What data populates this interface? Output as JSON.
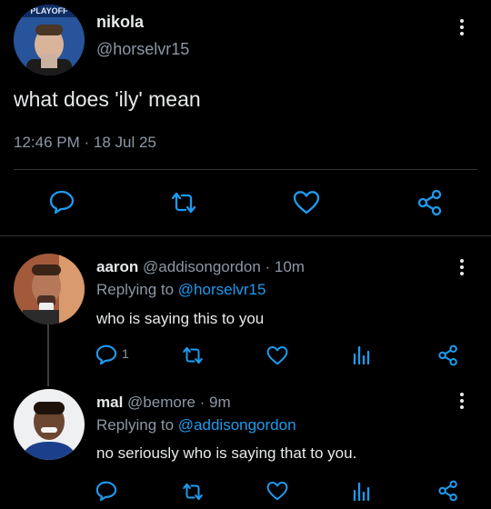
{
  "main_tweet": {
    "display_name": "nikola",
    "handle": "@horselvr15",
    "text": "what does 'ily' mean",
    "timestamp": "12:46 PM · 18 Jul 25",
    "avatar_badge": "PLAYOFF"
  },
  "replies": [
    {
      "display_name": "aaron",
      "handle": "@addisongordon",
      "time": "· 10m",
      "replying_prefix": "Replying to",
      "replying_to": "@horselvr15",
      "text": "who is saying this to you",
      "reply_count": "1"
    },
    {
      "display_name": "mal",
      "handle": "@bemore",
      "time": "· 9m",
      "replying_prefix": "Replying to",
      "replying_to": "@addisongordon",
      "text": "no seriously who is saying that to you."
    }
  ],
  "colors": {
    "background": "#000000",
    "text": "#e7e9ea",
    "muted": "#8b98a5",
    "link": "#1d9bf0",
    "divider": "#2f3336"
  },
  "icons": [
    "reply-icon",
    "retweet-icon",
    "like-icon",
    "share-icon",
    "analytics-icon",
    "more-icon"
  ]
}
